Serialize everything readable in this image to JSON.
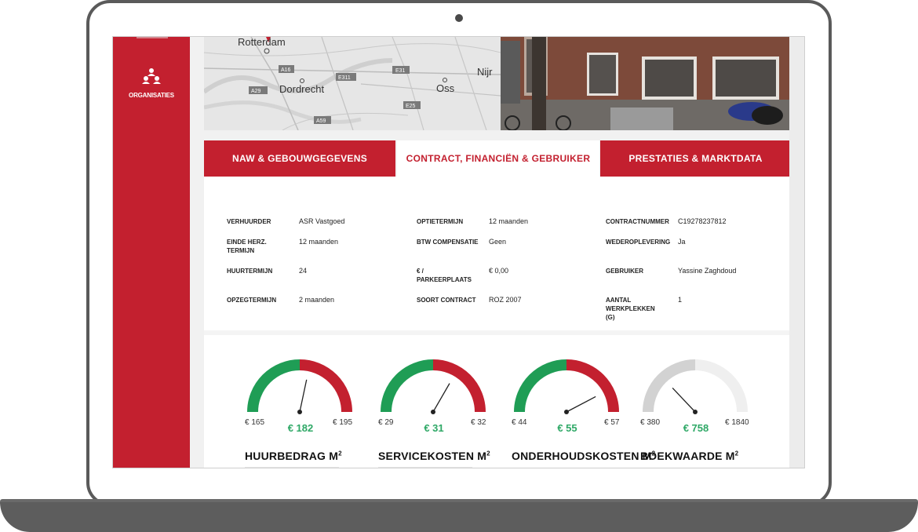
{
  "colors": {
    "brand_red": "#c3202f",
    "green": "#1f9d55",
    "value_green": "#2ea866",
    "grey_arc": "#d2d2d2"
  },
  "sidebar": {
    "org_label": "ORGANISATIES",
    "org_icon": "users-group-icon"
  },
  "map": {
    "labels": [
      "Rotterdam",
      "Dordrecht",
      "Oss",
      "Nijr"
    ],
    "road_labels": [
      "A16",
      "E311",
      "E31",
      "A29",
      "E25",
      "A59"
    ]
  },
  "tabs": [
    {
      "label": "NAW & GEBOUWGEGEVENS"
    },
    {
      "label": "CONTRACT, FINANCIËN & GEBRUIKER"
    },
    {
      "label": "PRESTATIES & MARKTDATA"
    }
  ],
  "details": {
    "col1": [
      {
        "label": "VERHUURDER",
        "value": "ASR Vastgoed"
      },
      {
        "label": "EINDE HERZ. TERMIJN",
        "value": "12 maanden"
      },
      {
        "label": "HUURTERMIJN",
        "value": "24"
      },
      {
        "label": "OPZEGTERMIJN",
        "value": "2 maanden"
      }
    ],
    "col2": [
      {
        "label": "OPTIETERMIJN",
        "value": "12 maanden"
      },
      {
        "label": "BTW COMPENSATIE",
        "value": "Geen"
      },
      {
        "label": "€ / PARKEERPLAATS",
        "value": "€ 0,00"
      },
      {
        "label": "SOORT CONTRACT",
        "value": "ROZ 2007"
      }
    ],
    "col3": [
      {
        "label": "CONTRACTNUMMER",
        "value": "C19278237812"
      },
      {
        "label": "WEDEROPLEVERING",
        "value": "Ja"
      },
      {
        "label": "GEBRUIKER",
        "value": "Yassine Zaghdoud"
      },
      {
        "label": "AANTAL WERKPLEKKEN (G)",
        "value": "1"
      }
    ]
  },
  "gauges": [
    {
      "title": "HUURBEDRAG M",
      "min": "€ 165",
      "max": "€ 195",
      "value": "€ 182",
      "min_n": 165,
      "max_n": 195,
      "value_n": 182,
      "style": "redgreen"
    },
    {
      "title": "SERVICEKOSTEN M",
      "min": "€ 29",
      "max": "€ 32",
      "value": "€ 31",
      "min_n": 29,
      "max_n": 32,
      "value_n": 31,
      "style": "redgreen"
    },
    {
      "title": "ONDERHOUDSKOSTEN M",
      "min": "€ 44",
      "max": "€ 57",
      "value": "€ 55",
      "min_n": 44,
      "max_n": 57,
      "value_n": 55,
      "style": "redgreen"
    },
    {
      "title": "BOEKWAARDE M",
      "min": "€ 380",
      "max": "€ 1840",
      "value": "€ 758",
      "min_n": 380,
      "max_n": 1840,
      "value_n": 758,
      "style": "grey"
    }
  ],
  "superscript": "2"
}
